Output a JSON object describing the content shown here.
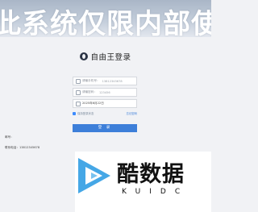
{
  "banner": {
    "text": "此系统仅限内部使用"
  },
  "logo": {
    "title": "自由王登录",
    "icon": "logo-icon"
  },
  "form": {
    "phone": {
      "label": "请输手机号：",
      "value": "13812345678",
      "icon": "user-icon"
    },
    "password": {
      "label": "请输密码：",
      "value": "123456",
      "icon": "lock-icon"
    },
    "date": {
      "value": "2025年6月22日",
      "icon": "calendar-icon"
    },
    "remember_label": "保持登录状态",
    "forgot_label": "忘记密码",
    "login_label": "登 录"
  },
  "left_info": {
    "line1": "邮号：",
    "line2": "联系电话：13812345678"
  },
  "watermark": {
    "title": "酷数据",
    "subtitle": "KUIDC"
  },
  "colors": {
    "accent": "#3d7fd9",
    "banner": "#b7c3d3"
  }
}
